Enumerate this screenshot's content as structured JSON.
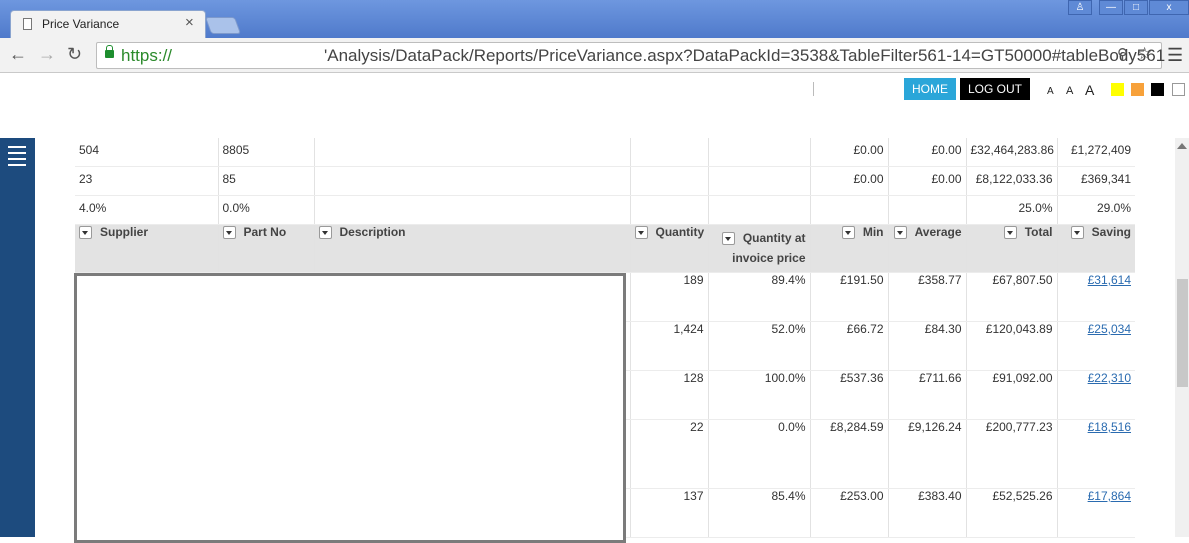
{
  "browser": {
    "tab_title": "Price Variance",
    "tab_close": "×",
    "url_scheme": "https://",
    "url_path": "'Analysis/DataPack/Reports/PriceVariance.aspx?DataPackId=3538&TableFilter561-14=GT50000#tableBody561",
    "window_buttons": [
      "♙",
      "—",
      "□",
      "x"
    ]
  },
  "header": {
    "home_label": "HOME",
    "logout_label": "LOG OUT",
    "font_sizes": [
      "A",
      "A",
      "A"
    ],
    "swatches": [
      "#ffff00",
      "#f7a13a",
      "#000000",
      "#ffffff"
    ]
  },
  "summary_rows": [
    [
      "504",
      "8805",
      "",
      "",
      "",
      "£0.00",
      "£0.00",
      "£32,464,283.86",
      "£1,272,409"
    ],
    [
      "23",
      "85",
      "",
      "",
      "",
      "£0.00",
      "£0.00",
      "£8,122,033.36",
      "£369,341"
    ],
    [
      "4.0%",
      "0.0%",
      "",
      "",
      "",
      "",
      "",
      "25.0%",
      "29.0%"
    ]
  ],
  "columns": [
    "Supplier",
    "Part No",
    "Description",
    "Quantity",
    "Quantity at invoice price",
    "Min",
    "Average",
    "Total",
    "Saving"
  ],
  "rows": [
    {
      "quantity": "189",
      "qty_invoice": "89.4%",
      "min": "£191.50",
      "average": "£358.77",
      "total": "£67,807.50",
      "saving": "£31,614"
    },
    {
      "quantity": "1,424",
      "qty_invoice": "52.0%",
      "min": "£66.72",
      "average": "£84.30",
      "total": "£120,043.89",
      "saving": "£25,034"
    },
    {
      "quantity": "128",
      "qty_invoice": "100.0%",
      "min": "£537.36",
      "average": "£711.66",
      "total": "£91,092.00",
      "saving": "£22,310"
    },
    {
      "quantity": "22",
      "qty_invoice": "0.0%",
      "min": "£8,284.59",
      "average": "£9,126.24",
      "total": "£200,777.23",
      "saving": "£18,516"
    },
    {
      "quantity": "137",
      "qty_invoice": "85.4%",
      "min": "£253.00",
      "average": "£383.40",
      "total": "£52,525.26",
      "saving": "£17,864"
    }
  ]
}
